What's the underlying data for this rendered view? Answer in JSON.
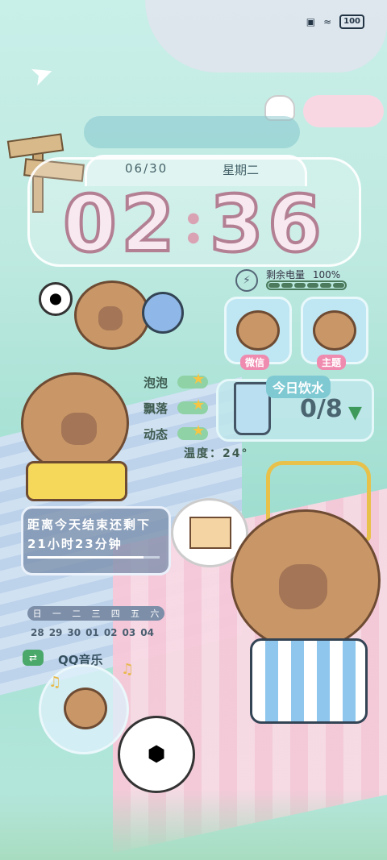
{
  "status_bar": {
    "battery_text": "100",
    "wifi_icon": "wifi-icon",
    "camera_icon": "camera-icon"
  },
  "clock": {
    "date": "06/30",
    "weekday": "星期二",
    "hour_1": "0",
    "hour_2": "2",
    "minute_1": "3",
    "minute_2": "6"
  },
  "battery_widget": {
    "label": "剩余电量",
    "percent_text": "100%",
    "level": 1.0
  },
  "apps": [
    {
      "label": "微信",
      "icon": "capybara-pair-icon"
    },
    {
      "label": "主题",
      "icon": "capybara-icon"
    }
  ],
  "toggles": [
    {
      "label": "泡泡"
    },
    {
      "label": "飘落"
    },
    {
      "label": "动态"
    }
  ],
  "water_widget": {
    "title": "今日饮水",
    "count": "0/8"
  },
  "temperature": "温度：24°",
  "countdown": {
    "line1": "距离今天结束还剩下",
    "line2": "21小时23分钟",
    "progress": 0.88
  },
  "calendar": {
    "weekdays": [
      "日",
      "一",
      "二",
      "三",
      "四",
      "五",
      "六"
    ],
    "dates": [
      "28",
      "29",
      "30",
      "01",
      "02",
      "03",
      "04"
    ]
  },
  "music": {
    "title": "QQ音乐"
  },
  "colors": {
    "pink_digit": "#f8e9f0",
    "digit_outline": "#b37f93",
    "accent_green": "#4b7a5c",
    "teal_bg": "#bde9e0"
  }
}
